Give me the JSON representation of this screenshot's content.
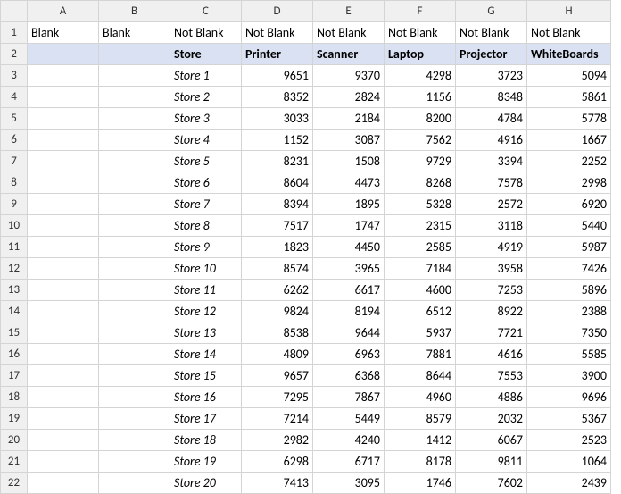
{
  "columns": [
    "A",
    "B",
    "C",
    "D",
    "E",
    "F",
    "G",
    "H"
  ],
  "row_count": 22,
  "row1": {
    "A": "Blank",
    "B": "Blank",
    "C": "Not Blank",
    "D": "Not Blank",
    "E": "Not Blank",
    "F": "Not Blank",
    "G": "Not Blank",
    "H": "Not Blank"
  },
  "row2_headers": {
    "C": "Store",
    "D": "Printer",
    "E": "Scanner",
    "F": "Laptop",
    "G": "Projector",
    "H": "WhiteBoards"
  },
  "data_rows": [
    {
      "store": "Store 1",
      "Printer": 9651,
      "Scanner": 9370,
      "Laptop": 4298,
      "Projector": 3723,
      "WhiteBoards": 5094
    },
    {
      "store": "Store 2",
      "Printer": 8352,
      "Scanner": 2824,
      "Laptop": 1156,
      "Projector": 8348,
      "WhiteBoards": 5861
    },
    {
      "store": "Store 3",
      "Printer": 3033,
      "Scanner": 2184,
      "Laptop": 8200,
      "Projector": 4784,
      "WhiteBoards": 5778
    },
    {
      "store": "Store 4",
      "Printer": 1152,
      "Scanner": 3087,
      "Laptop": 7562,
      "Projector": 4916,
      "WhiteBoards": 1667
    },
    {
      "store": "Store 5",
      "Printer": 8231,
      "Scanner": 1508,
      "Laptop": 9729,
      "Projector": 3394,
      "WhiteBoards": 2252
    },
    {
      "store": "Store 6",
      "Printer": 8604,
      "Scanner": 4473,
      "Laptop": 8268,
      "Projector": 7578,
      "WhiteBoards": 2998
    },
    {
      "store": "Store 7",
      "Printer": 8394,
      "Scanner": 1895,
      "Laptop": 5328,
      "Projector": 2572,
      "WhiteBoards": 6920
    },
    {
      "store": "Store 8",
      "Printer": 7517,
      "Scanner": 1747,
      "Laptop": 2315,
      "Projector": 3118,
      "WhiteBoards": 5440
    },
    {
      "store": "Store 9",
      "Printer": 1823,
      "Scanner": 4450,
      "Laptop": 2585,
      "Projector": 4919,
      "WhiteBoards": 5987
    },
    {
      "store": "Store 10",
      "Printer": 8574,
      "Scanner": 3965,
      "Laptop": 7184,
      "Projector": 3958,
      "WhiteBoards": 7426
    },
    {
      "store": "Store 11",
      "Printer": 6262,
      "Scanner": 6617,
      "Laptop": 4600,
      "Projector": 7253,
      "WhiteBoards": 5896
    },
    {
      "store": "Store 12",
      "Printer": 9824,
      "Scanner": 8194,
      "Laptop": 6512,
      "Projector": 8922,
      "WhiteBoards": 2388
    },
    {
      "store": "Store 13",
      "Printer": 8538,
      "Scanner": 9644,
      "Laptop": 5937,
      "Projector": 7721,
      "WhiteBoards": 7350
    },
    {
      "store": "Store 14",
      "Printer": 4809,
      "Scanner": 6963,
      "Laptop": 7881,
      "Projector": 4616,
      "WhiteBoards": 5585
    },
    {
      "store": "Store 15",
      "Printer": 9657,
      "Scanner": 6368,
      "Laptop": 8644,
      "Projector": 7553,
      "WhiteBoards": 3900
    },
    {
      "store": "Store 16",
      "Printer": 7295,
      "Scanner": 7867,
      "Laptop": 4960,
      "Projector": 4886,
      "WhiteBoards": 9696
    },
    {
      "store": "Store 17",
      "Printer": 7214,
      "Scanner": 5449,
      "Laptop": 8579,
      "Projector": 2032,
      "WhiteBoards": 5367
    },
    {
      "store": "Store 18",
      "Printer": 2982,
      "Scanner": 4240,
      "Laptop": 1412,
      "Projector": 6067,
      "WhiteBoards": 2523
    },
    {
      "store": "Store 19",
      "Printer": 6298,
      "Scanner": 6717,
      "Laptop": 8178,
      "Projector": 9811,
      "WhiteBoards": 1064
    },
    {
      "store": "Store 20",
      "Printer": 7413,
      "Scanner": 3095,
      "Laptop": 1746,
      "Projector": 7602,
      "WhiteBoards": 2439
    }
  ],
  "chart_data": {
    "type": "table",
    "title": "Store inventory counts",
    "categories": [
      "Printer",
      "Scanner",
      "Laptop",
      "Projector",
      "WhiteBoards"
    ],
    "series": [
      {
        "name": "Store 1",
        "values": [
          9651,
          9370,
          4298,
          3723,
          5094
        ]
      },
      {
        "name": "Store 2",
        "values": [
          8352,
          2824,
          1156,
          8348,
          5861
        ]
      },
      {
        "name": "Store 3",
        "values": [
          3033,
          2184,
          8200,
          4784,
          5778
        ]
      },
      {
        "name": "Store 4",
        "values": [
          1152,
          3087,
          7562,
          4916,
          1667
        ]
      },
      {
        "name": "Store 5",
        "values": [
          8231,
          1508,
          9729,
          3394,
          2252
        ]
      },
      {
        "name": "Store 6",
        "values": [
          8604,
          4473,
          8268,
          7578,
          2998
        ]
      },
      {
        "name": "Store 7",
        "values": [
          8394,
          1895,
          5328,
          2572,
          6920
        ]
      },
      {
        "name": "Store 8",
        "values": [
          7517,
          1747,
          2315,
          3118,
          5440
        ]
      },
      {
        "name": "Store 9",
        "values": [
          1823,
          4450,
          2585,
          4919,
          5987
        ]
      },
      {
        "name": "Store 10",
        "values": [
          8574,
          3965,
          7184,
          3958,
          7426
        ]
      },
      {
        "name": "Store 11",
        "values": [
          6262,
          6617,
          4600,
          7253,
          5896
        ]
      },
      {
        "name": "Store 12",
        "values": [
          9824,
          8194,
          6512,
          8922,
          2388
        ]
      },
      {
        "name": "Store 13",
        "values": [
          8538,
          9644,
          5937,
          7721,
          7350
        ]
      },
      {
        "name": "Store 14",
        "values": [
          4809,
          6963,
          7881,
          4616,
          5585
        ]
      },
      {
        "name": "Store 15",
        "values": [
          9657,
          6368,
          8644,
          7553,
          3900
        ]
      },
      {
        "name": "Store 16",
        "values": [
          7295,
          7867,
          4960,
          4886,
          9696
        ]
      },
      {
        "name": "Store 17",
        "values": [
          7214,
          5449,
          8579,
          2032,
          5367
        ]
      },
      {
        "name": "Store 18",
        "values": [
          2982,
          4240,
          1412,
          6067,
          2523
        ]
      },
      {
        "name": "Store 19",
        "values": [
          6298,
          6717,
          8178,
          9811,
          1064
        ]
      },
      {
        "name": "Store 20",
        "values": [
          7413,
          3095,
          1746,
          7602,
          2439
        ]
      }
    ]
  }
}
